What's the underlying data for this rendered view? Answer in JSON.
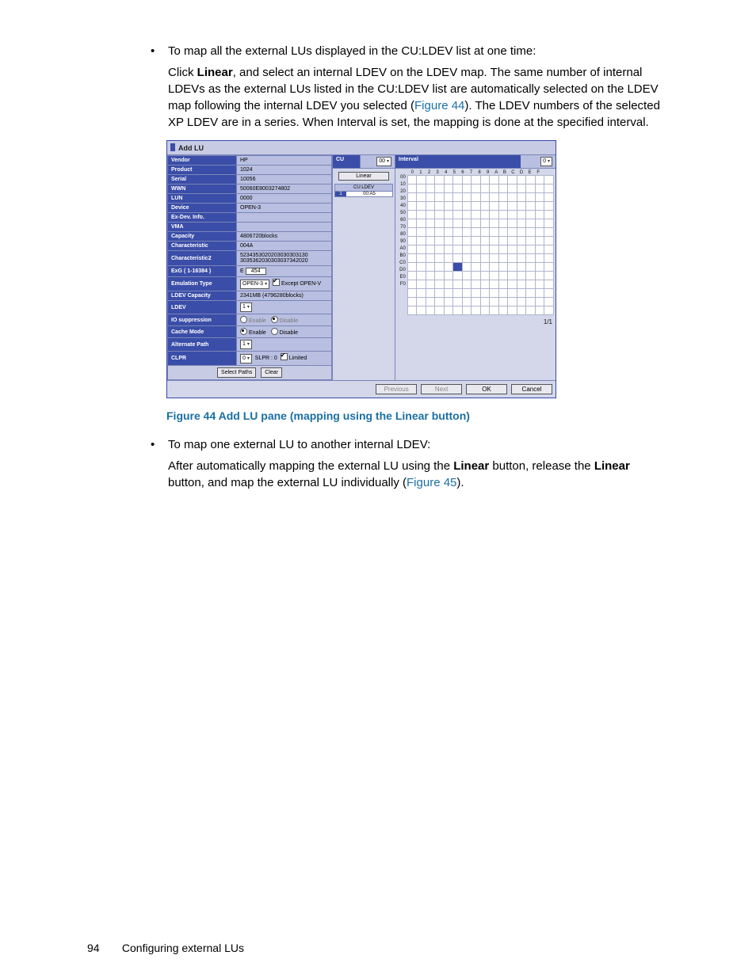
{
  "body": {
    "bullet1": "To map all the external LUs displayed in the CU:LDEV list at one time:",
    "para1_a": "Click ",
    "para1_bold1": "Linear",
    "para1_b": ", and select an internal LDEV on the LDEV map. The same number of internal LDEVs as the external LUs listed in the CU:LDEV list are automatically selected on the LDEV map following the internal LDEV you selected (",
    "para1_link": "Figure 44",
    "para1_c": "). The LDEV numbers of the selected XP LDEV are in a series. When Interval is set, the mapping is done at the specified interval.",
    "figcaption": "Figure 44 Add LU pane (mapping using the Linear button)",
    "bullet2": "To map one external LU to another internal LDEV:",
    "para2_a": "After automatically mapping the external LU using the ",
    "para2_bold1": "Linear",
    "para2_b": " button, release the ",
    "para2_bold2": "Linear",
    "para2_c": " button, and map the external LU individually (",
    "para2_link": "Figure 45",
    "para2_d": ")."
  },
  "pane": {
    "title": "Add LU",
    "props": [
      {
        "label": "Vendor",
        "value": "HP"
      },
      {
        "label": "Product",
        "value": "1024"
      },
      {
        "label": "Serial",
        "value": "10056"
      },
      {
        "label": "WWN",
        "value": "50060E8003274802"
      },
      {
        "label": "LUN",
        "value": "0000"
      },
      {
        "label": "Device",
        "value": "OPEN-3"
      },
      {
        "label": "Ex-Dev. Info.",
        "value": ""
      },
      {
        "label": "VMA",
        "value": ""
      },
      {
        "label": "Capacity",
        "value": "4806720blocks"
      },
      {
        "label": "Characteristic",
        "value": "004A"
      },
      {
        "label": "Characteristic2",
        "value": "5234353020203030303130 3035362030303037342020"
      }
    ],
    "exg": {
      "label": "ExG ( 1-16384 )",
      "prefix": "E",
      "value": "454"
    },
    "emutype": {
      "label": "Emulation Type",
      "value": "OPEN-3",
      "except": "Except OPEN-V",
      "except_on": true
    },
    "ldevcap": {
      "label": "LDEV Capacity",
      "value": "2341MB (4796280blocks)"
    },
    "ldev": {
      "label": "LDEV",
      "value": "1"
    },
    "iosup": {
      "label": "IO suppression",
      "enable": "Enable",
      "disable": "Disable",
      "enable_on": false,
      "disable_on": true,
      "dim": true
    },
    "cache": {
      "label": "Cache Mode",
      "enable": "Enable",
      "disable": "Disable",
      "enable_on": true,
      "disable_on": false
    },
    "altpath": {
      "label": "Alternate Path",
      "value": "1"
    },
    "clpr": {
      "label": "CLPR",
      "value": "0",
      "slpr": "SLPR : 0",
      "limited": "Limited",
      "limited_on": true
    },
    "btn_selectpaths": "Select Paths",
    "btn_clear": "Clear",
    "cu": {
      "label": "CU",
      "value": "00"
    },
    "interval": {
      "label": "Interval",
      "value": "0"
    },
    "linear_btn": "Linear",
    "culdev_head": "CU:LDEV",
    "culdev_row": {
      "idx": "1",
      "val": "00:A5"
    },
    "grid_cols": [
      "0",
      "1",
      "2",
      "3",
      "4",
      "5",
      "6",
      "7",
      "8",
      "9",
      "A",
      "B",
      "C",
      "D",
      "E",
      "F"
    ],
    "grid_rows": [
      "00",
      "10",
      "20",
      "30",
      "40",
      "50",
      "60",
      "70",
      "80",
      "90",
      "A0",
      "B0",
      "C0",
      "D0",
      "E0",
      "F0"
    ],
    "sel_cell": {
      "row": "A0",
      "col": 5
    },
    "page": "1/1",
    "btn_prev": "Previous",
    "btn_next": "Next",
    "btn_ok": "OK",
    "btn_cancel": "Cancel"
  },
  "footer": {
    "pagenum": "94",
    "section": "Configuring external LUs"
  }
}
